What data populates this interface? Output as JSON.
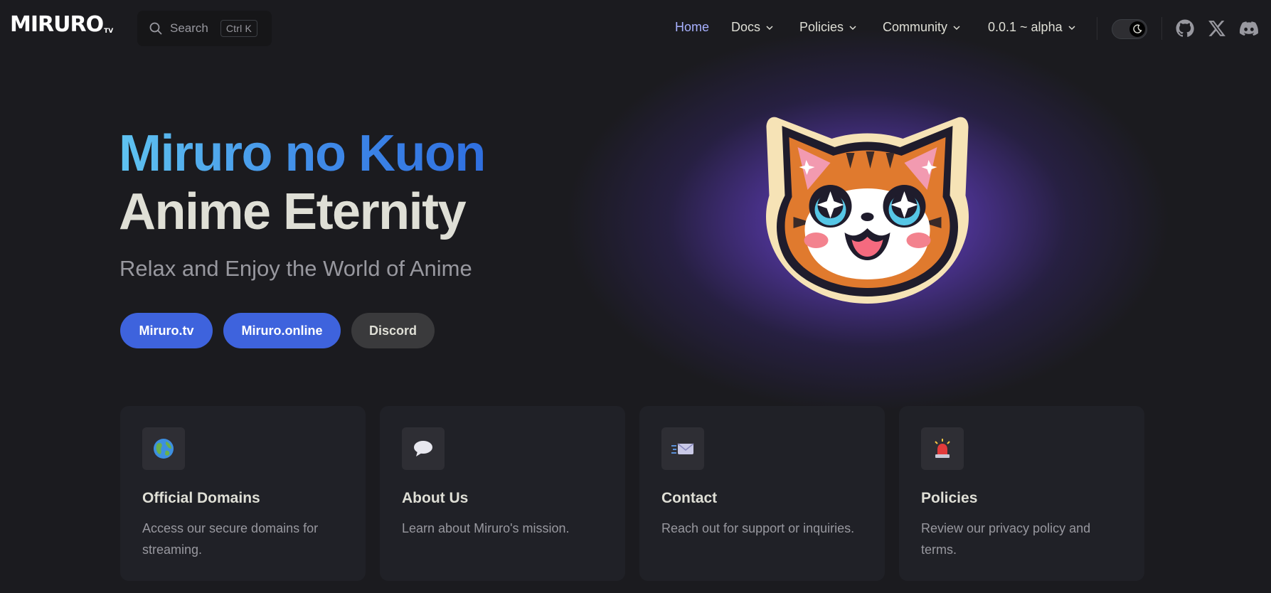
{
  "brand": {
    "logo_text": "MIRURO",
    "logo_suffix": "TV"
  },
  "search": {
    "label": "Search",
    "shortcut": "Ctrl K"
  },
  "nav": {
    "items": [
      {
        "label": "Home",
        "active": true
      },
      {
        "label": "Docs",
        "dropdown": true
      },
      {
        "label": "Policies",
        "dropdown": true
      },
      {
        "label": "Community",
        "dropdown": true
      },
      {
        "label": "0.0.1 ~ alpha",
        "dropdown": true
      }
    ],
    "appearance_toggle": {
      "mode": "dark",
      "icon": "moon-icon"
    },
    "social": [
      "github-icon",
      "x-icon",
      "discord-icon"
    ]
  },
  "hero": {
    "name": "Miruro no Kuon",
    "text": "Anime Eternity",
    "tagline": "Relax and Enjoy the World of Anime",
    "actions": [
      {
        "label": "Miruro.tv",
        "theme": "brand"
      },
      {
        "label": "Miruro.online",
        "theme": "brand"
      },
      {
        "label": "Discord",
        "theme": "alt"
      }
    ],
    "image": "cat-mascot"
  },
  "features": [
    {
      "icon": "globe-icon",
      "emoji": "🌎",
      "title": "Official Domains",
      "details": "Access our secure domains for streaming."
    },
    {
      "icon": "speech-bubble-icon",
      "emoji": "💬",
      "title": "About Us",
      "details": "Learn about Miruro's mission."
    },
    {
      "icon": "envelope-icon",
      "emoji": "📨",
      "title": "Contact",
      "details": "Reach out for support or inquiries."
    },
    {
      "icon": "siren-icon",
      "emoji": "🚨",
      "title": "Policies",
      "details": "Review our privacy policy and terms."
    }
  ],
  "colors": {
    "background": "#1b1b1f",
    "brand": "#3e63dd",
    "active_link": "#a8b1ff",
    "card": "#202127",
    "glow": "#7a52e0"
  }
}
